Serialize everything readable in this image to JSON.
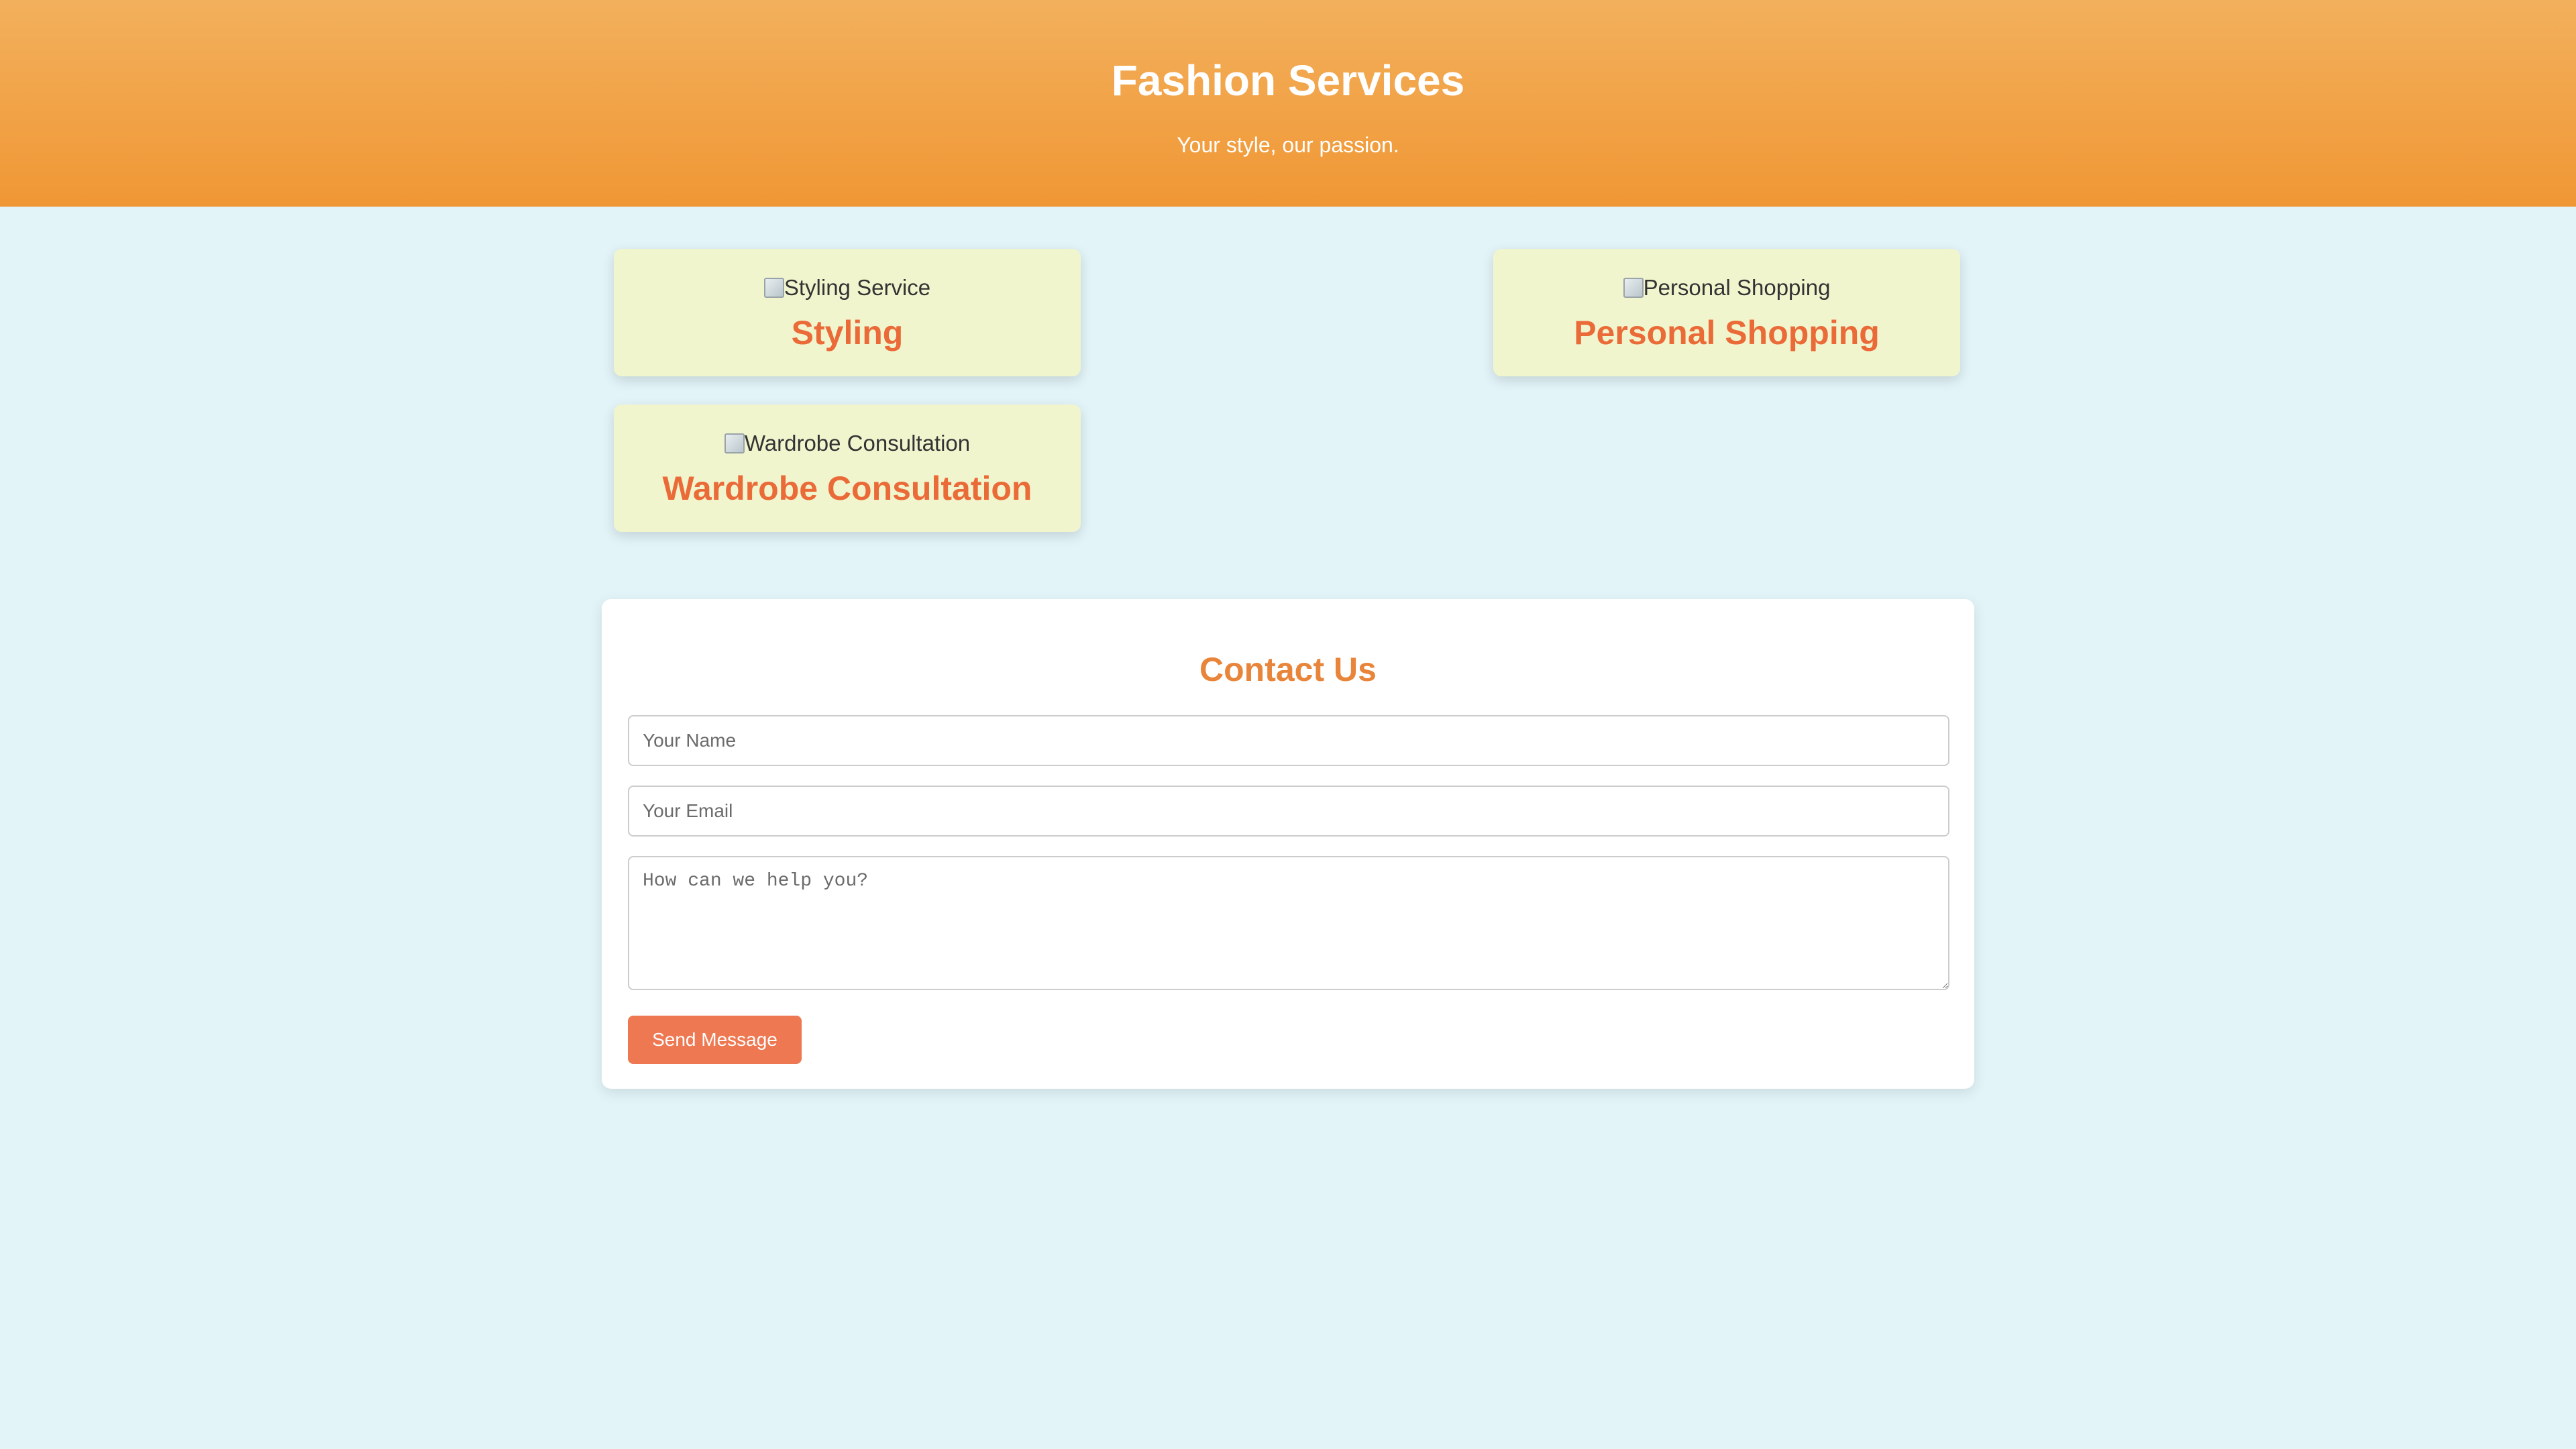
{
  "header": {
    "title": "Fashion Services",
    "tagline": "Your style, our passion."
  },
  "services": [
    {
      "image_alt": "Styling Service",
      "title": "Styling"
    },
    {
      "image_alt": "Personal Shopping",
      "title": "Personal Shopping"
    },
    {
      "image_alt": "Wardrobe Consultation",
      "title": "Wardrobe Consultation"
    }
  ],
  "contact": {
    "title": "Contact Us",
    "name_placeholder": "Your Name",
    "name_value": "",
    "email_placeholder": "Your Email",
    "email_value": "",
    "message_placeholder": "How can we help you?",
    "message_value": "",
    "submit_label": "Send Message"
  },
  "colors": {
    "header_gradient_top": "#f3b05c",
    "header_gradient_bottom": "#f09735",
    "page_background": "#e2f4f8",
    "card_background": "#f1f5ce",
    "service_title": "#ea6a38",
    "contact_title": "#e8853a",
    "button": "#ee7852"
  },
  "icons": {
    "service_image": "broken-image-icon"
  }
}
